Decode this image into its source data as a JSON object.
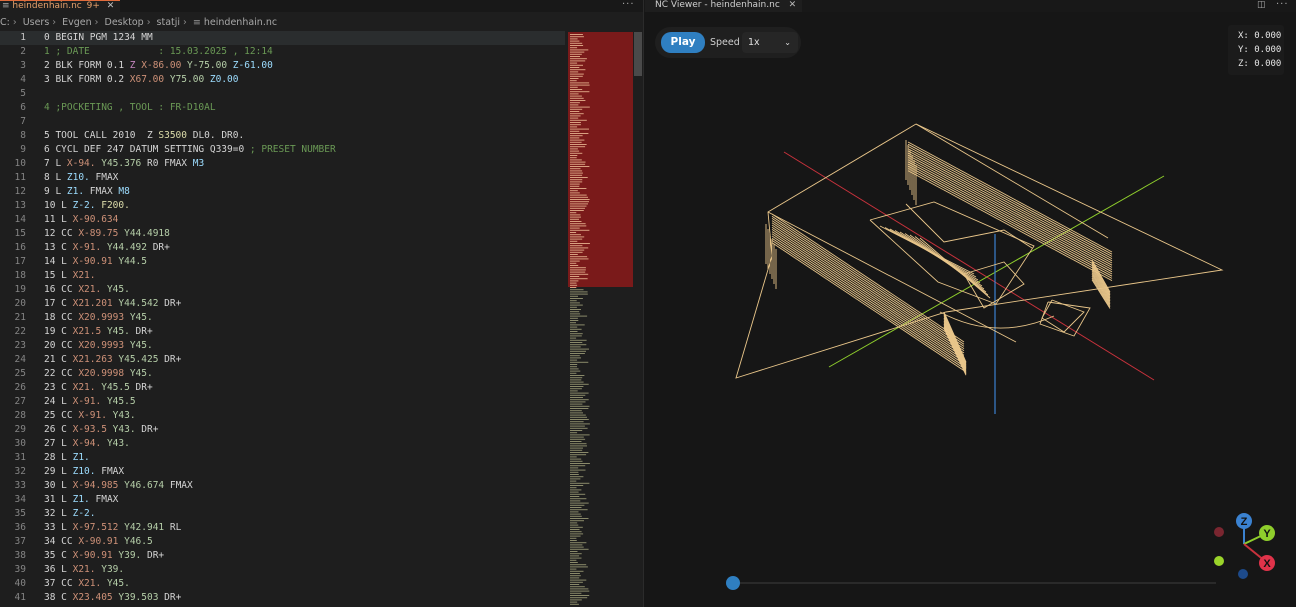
{
  "tabs": {
    "editor_file": "heindenhain.nc",
    "editor_modified": "9+",
    "viewer_title": "NC Viewer - heindenhain.nc"
  },
  "breadcrumb": [
    "C:",
    "Users",
    "Evgen",
    "Desktop",
    "statji",
    "heindenhain.nc"
  ],
  "code_lines": [
    {
      "n": "1",
      "seg": [
        [
          "t-d",
          "0 BEGIN PGM 1234 MM"
        ]
      ]
    },
    {
      "n": "2",
      "seg": [
        [
          "t-c",
          "1 ; DATE            : 15.03.2025 , 12:14"
        ]
      ]
    },
    {
      "n": "3",
      "seg": [
        [
          "t-d",
          "2 BLK FORM 0.1 "
        ],
        [
          "t-z",
          "Z "
        ],
        [
          "t-x",
          "X-86.00 "
        ],
        [
          "t-y",
          "Y-75.00 "
        ],
        [
          "t-z2",
          "Z-61.00"
        ]
      ]
    },
    {
      "n": "4",
      "seg": [
        [
          "t-d",
          "3 BLK FORM 0.2 "
        ],
        [
          "t-x",
          "X67.00 "
        ],
        [
          "t-y",
          "Y75.00 "
        ],
        [
          "t-z2",
          "Z0.00"
        ]
      ]
    },
    {
      "n": "5",
      "seg": [
        [
          "t-d",
          ""
        ]
      ]
    },
    {
      "n": "6",
      "seg": [
        [
          "t-c",
          "4 ;POCKETING , TOOL : FR-D10AL"
        ]
      ]
    },
    {
      "n": "7",
      "seg": [
        [
          "t-d",
          ""
        ]
      ]
    },
    {
      "n": "8",
      "seg": [
        [
          "t-d",
          "5 TOOL CALL 2010  Z "
        ],
        [
          "t-f",
          "S3500 "
        ],
        [
          "t-d",
          "DL0. DR0."
        ]
      ]
    },
    {
      "n": "9",
      "seg": [
        [
          "t-d",
          "6 CYCL DEF 247 DATUM SETTING Q339=0 "
        ],
        [
          "t-c",
          "; PRESET NUMBER"
        ]
      ]
    },
    {
      "n": "10",
      "seg": [
        [
          "t-d",
          "7 L "
        ],
        [
          "t-x",
          "X-94. "
        ],
        [
          "t-y",
          "Y45.376 "
        ],
        [
          "t-d",
          "R0 FMAX "
        ],
        [
          "t-m",
          "M3"
        ]
      ]
    },
    {
      "n": "11",
      "seg": [
        [
          "t-d",
          "8 L "
        ],
        [
          "t-z2",
          "Z10. "
        ],
        [
          "t-d",
          "FMAX"
        ]
      ]
    },
    {
      "n": "12",
      "seg": [
        [
          "t-d",
          "9 L "
        ],
        [
          "t-z2",
          "Z1. "
        ],
        [
          "t-d",
          "FMAX "
        ],
        [
          "t-m",
          "M8"
        ]
      ]
    },
    {
      "n": "13",
      "seg": [
        [
          "t-d",
          "10 L "
        ],
        [
          "t-z2",
          "Z-2. "
        ],
        [
          "t-f",
          "F200."
        ]
      ]
    },
    {
      "n": "14",
      "seg": [
        [
          "t-d",
          "11 L "
        ],
        [
          "t-x",
          "X-90.634"
        ]
      ]
    },
    {
      "n": "15",
      "seg": [
        [
          "t-d",
          "12 CC "
        ],
        [
          "t-x",
          "X-89.75 "
        ],
        [
          "t-y",
          "Y44.4918"
        ]
      ]
    },
    {
      "n": "16",
      "seg": [
        [
          "t-d",
          "13 C "
        ],
        [
          "t-x",
          "X-91. "
        ],
        [
          "t-y",
          "Y44.492 "
        ],
        [
          "t-d",
          "DR+"
        ]
      ]
    },
    {
      "n": "17",
      "seg": [
        [
          "t-d",
          "14 L "
        ],
        [
          "t-x",
          "X-90.91 "
        ],
        [
          "t-y",
          "Y44.5"
        ]
      ]
    },
    {
      "n": "18",
      "seg": [
        [
          "t-d",
          "15 L "
        ],
        [
          "t-x",
          "X21."
        ]
      ]
    },
    {
      "n": "19",
      "seg": [
        [
          "t-d",
          "16 CC "
        ],
        [
          "t-x",
          "X21. "
        ],
        [
          "t-y",
          "Y45."
        ]
      ]
    },
    {
      "n": "20",
      "seg": [
        [
          "t-d",
          "17 C "
        ],
        [
          "t-x",
          "X21.201 "
        ],
        [
          "t-y",
          "Y44.542 "
        ],
        [
          "t-d",
          "DR+"
        ]
      ]
    },
    {
      "n": "21",
      "seg": [
        [
          "t-d",
          "18 CC "
        ],
        [
          "t-x",
          "X20.9993 "
        ],
        [
          "t-y",
          "Y45."
        ]
      ]
    },
    {
      "n": "22",
      "seg": [
        [
          "t-d",
          "19 C "
        ],
        [
          "t-x",
          "X21.5 "
        ],
        [
          "t-y",
          "Y45. "
        ],
        [
          "t-d",
          "DR+"
        ]
      ]
    },
    {
      "n": "23",
      "seg": [
        [
          "t-d",
          "20 CC "
        ],
        [
          "t-x",
          "X20.9993 "
        ],
        [
          "t-y",
          "Y45."
        ]
      ]
    },
    {
      "n": "24",
      "seg": [
        [
          "t-d",
          "21 C "
        ],
        [
          "t-x",
          "X21.263 "
        ],
        [
          "t-y",
          "Y45.425 "
        ],
        [
          "t-d",
          "DR+"
        ]
      ]
    },
    {
      "n": "25",
      "seg": [
        [
          "t-d",
          "22 CC "
        ],
        [
          "t-x",
          "X20.9998 "
        ],
        [
          "t-y",
          "Y45."
        ]
      ]
    },
    {
      "n": "26",
      "seg": [
        [
          "t-d",
          "23 C "
        ],
        [
          "t-x",
          "X21. "
        ],
        [
          "t-y",
          "Y45.5 "
        ],
        [
          "t-d",
          "DR+"
        ]
      ]
    },
    {
      "n": "27",
      "seg": [
        [
          "t-d",
          "24 L "
        ],
        [
          "t-x",
          "X-91. "
        ],
        [
          "t-y",
          "Y45.5"
        ]
      ]
    },
    {
      "n": "28",
      "seg": [
        [
          "t-d",
          "25 CC "
        ],
        [
          "t-x",
          "X-91. "
        ],
        [
          "t-y",
          "Y43."
        ]
      ]
    },
    {
      "n": "29",
      "seg": [
        [
          "t-d",
          "26 C "
        ],
        [
          "t-x",
          "X-93.5 "
        ],
        [
          "t-y",
          "Y43. "
        ],
        [
          "t-d",
          "DR+"
        ]
      ]
    },
    {
      "n": "30",
      "seg": [
        [
          "t-d",
          "27 L "
        ],
        [
          "t-x",
          "X-94. "
        ],
        [
          "t-y",
          "Y43."
        ]
      ]
    },
    {
      "n": "31",
      "seg": [
        [
          "t-d",
          "28 L "
        ],
        [
          "t-z2",
          "Z1."
        ]
      ]
    },
    {
      "n": "32",
      "seg": [
        [
          "t-d",
          "29 L "
        ],
        [
          "t-z2",
          "Z10. "
        ],
        [
          "t-d",
          "FMAX"
        ]
      ]
    },
    {
      "n": "33",
      "seg": [
        [
          "t-d",
          "30 L "
        ],
        [
          "t-x",
          "X-94.985 "
        ],
        [
          "t-y",
          "Y46.674 "
        ],
        [
          "t-d",
          "FMAX"
        ]
      ]
    },
    {
      "n": "34",
      "seg": [
        [
          "t-d",
          "31 L "
        ],
        [
          "t-z2",
          "Z1. "
        ],
        [
          "t-d",
          "FMAX"
        ]
      ]
    },
    {
      "n": "35",
      "seg": [
        [
          "t-d",
          "32 L "
        ],
        [
          "t-z2",
          "Z-2."
        ]
      ]
    },
    {
      "n": "36",
      "seg": [
        [
          "t-d",
          "33 L "
        ],
        [
          "t-x",
          "X-97.512 "
        ],
        [
          "t-y",
          "Y42.941 "
        ],
        [
          "t-d",
          "RL"
        ]
      ]
    },
    {
      "n": "37",
      "seg": [
        [
          "t-d",
          "34 CC "
        ],
        [
          "t-x",
          "X-90.91 "
        ],
        [
          "t-y",
          "Y46.5"
        ]
      ]
    },
    {
      "n": "38",
      "seg": [
        [
          "t-d",
          "35 C "
        ],
        [
          "t-x",
          "X-90.91 "
        ],
        [
          "t-y",
          "Y39. "
        ],
        [
          "t-d",
          "DR+"
        ]
      ]
    },
    {
      "n": "39",
      "seg": [
        [
          "t-d",
          "36 L "
        ],
        [
          "t-x",
          "X21. "
        ],
        [
          "t-y",
          "Y39."
        ]
      ]
    },
    {
      "n": "40",
      "seg": [
        [
          "t-d",
          "37 CC "
        ],
        [
          "t-x",
          "X21. "
        ],
        [
          "t-y",
          "Y45."
        ]
      ]
    },
    {
      "n": "41",
      "seg": [
        [
          "t-d",
          "38 C "
        ],
        [
          "t-x",
          "X23.405 "
        ],
        [
          "t-y",
          "Y39.503 "
        ],
        [
          "t-d",
          "DR+"
        ]
      ]
    }
  ],
  "current_line": "1",
  "viewer": {
    "play_label": "Play",
    "speed_label": "Speed",
    "speed_value": "1x",
    "x_readout": "X: 0.000",
    "y_readout": "Y: 0.000",
    "z_readout": "Z: 0.000",
    "playback_progress": 0.0
  },
  "gizmo": {
    "z_label": "Z",
    "y_label": "Y",
    "x_label": "X"
  },
  "colors": {
    "accent": "#2f7fc1",
    "toolpath": "#e9c68a",
    "axis_x": "#c8323c",
    "axis_y": "#8fce2c",
    "axis_z": "#2f7fc1",
    "tab_modified": "#e5a06a"
  }
}
